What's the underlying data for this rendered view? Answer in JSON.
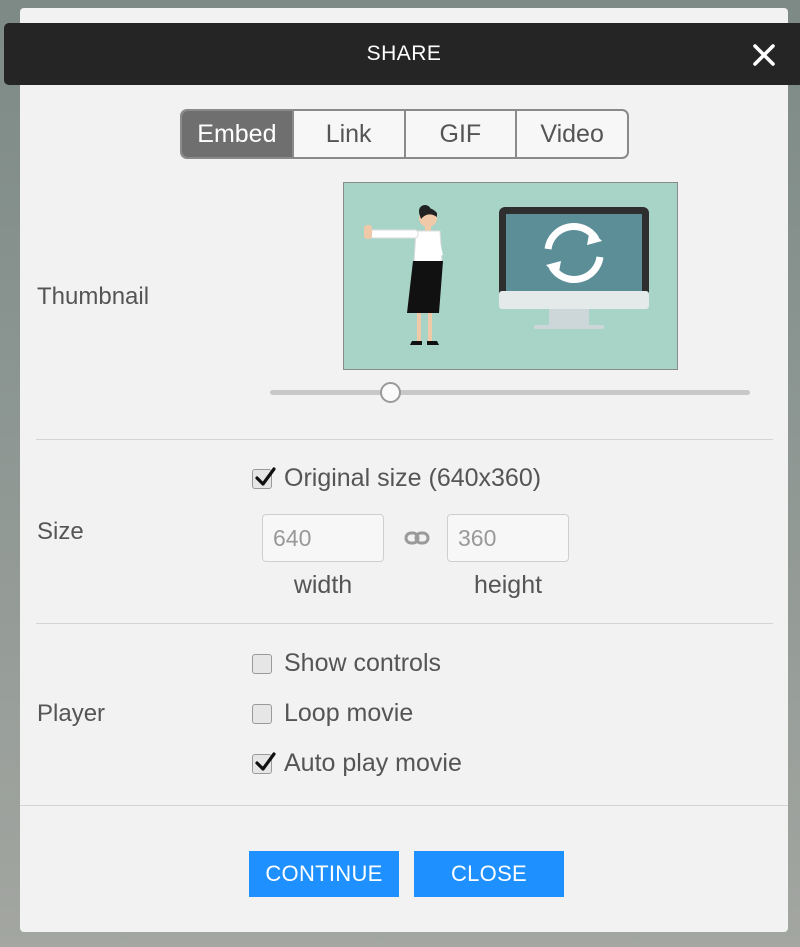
{
  "dialog": {
    "title": "SHARE",
    "close_icon": "close-icon"
  },
  "tabs": [
    {
      "label": "Embed",
      "active": true
    },
    {
      "label": "Link",
      "active": false
    },
    {
      "label": "GIF",
      "active": false
    },
    {
      "label": "Video",
      "active": false
    }
  ],
  "thumbnail": {
    "label": "Thumbnail",
    "slider_value_fraction": 0.25
  },
  "size": {
    "label": "Size",
    "original_size": {
      "label": "Original size (640x360)",
      "checked": true
    },
    "width": {
      "placeholder": "640",
      "label": "width"
    },
    "height": {
      "placeholder": "360",
      "label": "height"
    },
    "link_icon": "chain-link-icon"
  },
  "player": {
    "label": "Player",
    "options": [
      {
        "label": "Show controls",
        "checked": false
      },
      {
        "label": "Loop movie",
        "checked": false
      },
      {
        "label": "Auto play movie",
        "checked": true
      }
    ]
  },
  "buttons": {
    "continue_label": "CONTINUE",
    "close_label": "CLOSE"
  },
  "colors": {
    "titlebar": "#252525",
    "accent": "#1e90ff",
    "active_tab": "#6f6f6f",
    "thumbnail_bg": "#a8d3c7"
  }
}
